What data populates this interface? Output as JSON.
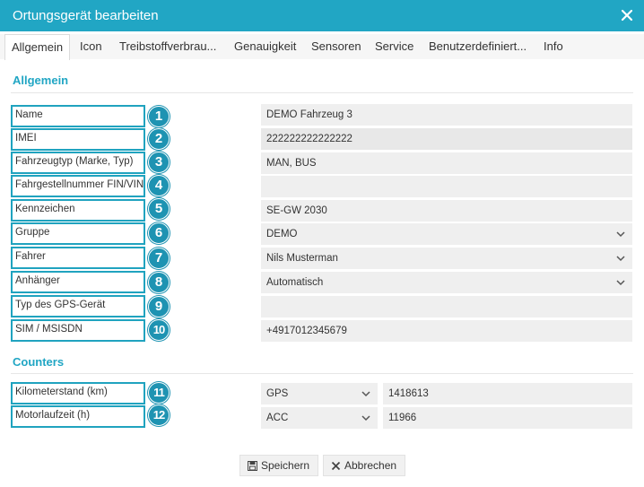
{
  "dialog": {
    "title": "Ortungsgerät bearbeiten"
  },
  "tabs": [
    {
      "label": "Allgemein",
      "active": true
    },
    {
      "label": "Icon"
    },
    {
      "label": "Treibstoffverbrau..."
    },
    {
      "label": "Genauigkeit"
    },
    {
      "label": "Sensoren"
    },
    {
      "label": "Service"
    },
    {
      "label": "Benutzerdefiniert..."
    },
    {
      "label": "Info"
    }
  ],
  "sections": {
    "general": "Allgemein",
    "counters": "Counters"
  },
  "general_fields": [
    {
      "label": "Name",
      "badge": "1",
      "value": "DEMO Fahrzeug 3",
      "type": "text"
    },
    {
      "label": "IMEI",
      "badge": "2",
      "value": "222222222222222",
      "type": "readonly"
    },
    {
      "label": "Fahrzeugtyp (Marke, Typ)",
      "badge": "3",
      "value": "MAN, BUS",
      "type": "text"
    },
    {
      "label": "Fahrgestellnummer FIN/VIN",
      "badge": "4",
      "value": "",
      "type": "text"
    },
    {
      "label": "Kennzeichen",
      "badge": "5",
      "value": "SE-GW 2030",
      "type": "text"
    },
    {
      "label": "Gruppe",
      "badge": "6",
      "value": "DEMO",
      "type": "select"
    },
    {
      "label": "Fahrer",
      "badge": "7",
      "value": "Nils Musterman",
      "type": "select"
    },
    {
      "label": "Anhänger",
      "badge": "8",
      "value": "Automatisch",
      "type": "select"
    },
    {
      "label": "Typ des GPS-Gerät",
      "badge": "9",
      "value": "",
      "type": "text"
    },
    {
      "label": "SIM / MSISDN",
      "badge": "10",
      "value": "+4917012345679",
      "type": "text"
    }
  ],
  "counters": [
    {
      "label": "Kilometerstand (km)",
      "badge": "11",
      "source": "GPS",
      "value": "1418613"
    },
    {
      "label": "Motorlaufzeit (h)",
      "badge": "12",
      "source": "ACC",
      "value": "11966"
    }
  ],
  "buttons": {
    "save": "Speichern",
    "cancel": "Abbrechen"
  },
  "colors": {
    "accent": "#21a6c4",
    "badge": "#1e93b2",
    "field": "#efefef"
  },
  "icons": {
    "close": "close-icon",
    "chevron": "chevron-down-icon",
    "save": "floppy-disk-icon",
    "cancel": "cross-icon"
  }
}
